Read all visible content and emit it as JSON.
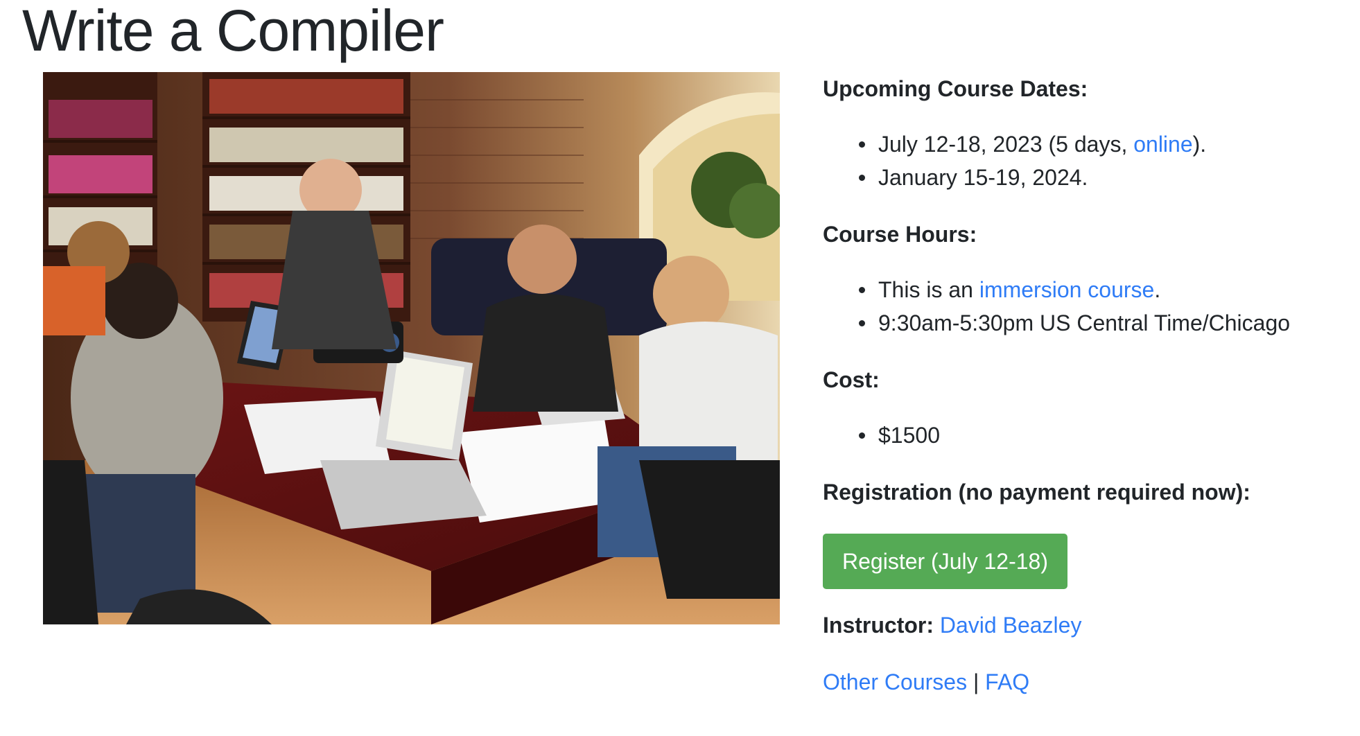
{
  "page": {
    "title": "Write a Compiler"
  },
  "photo": {
    "subject": "Students at laptops in a classroom with bookshelves",
    "icon": "classroom-photo"
  },
  "dates": {
    "heading": "Upcoming Course Dates:",
    "items": [
      {
        "text_before": "July 12-18, 2023 (5 days, ",
        "link": "online",
        "text_after": ")."
      },
      {
        "text": "January 15-19, 2024."
      }
    ]
  },
  "hours": {
    "heading": "Course Hours:",
    "items": [
      {
        "text_before": "This is an ",
        "link": "immersion course",
        "text_after": "."
      },
      {
        "text": "9:30am-5:30pm US Central Time/Chicago"
      }
    ]
  },
  "cost": {
    "heading": "Cost:",
    "items": [
      {
        "text": "$1500"
      }
    ]
  },
  "registration": {
    "heading": "Registration (no payment required now):",
    "button_label": "Register (July 12-18)"
  },
  "instructor": {
    "label": "Instructor:",
    "name": "David Beazley"
  },
  "footer_links": {
    "other_courses": "Other Courses",
    "separator": "|",
    "faq": "FAQ"
  },
  "colors": {
    "link": "#2f7cf6",
    "button": "#55aa55",
    "text": "#212529"
  }
}
